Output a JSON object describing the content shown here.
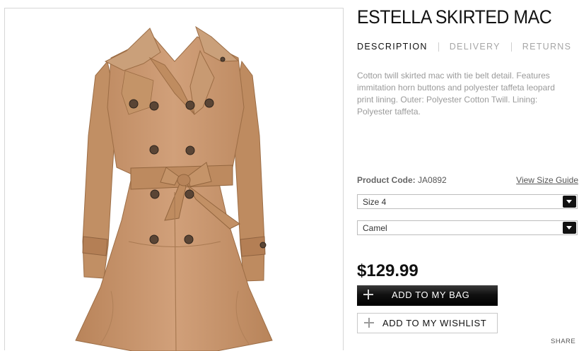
{
  "product": {
    "title": "ESTELLA SKIRTED MAC",
    "tabs": [
      "DESCRIPTION",
      "DELIVERY",
      "RETURNS"
    ],
    "active_tab": "DESCRIPTION",
    "description": "Cotton twill skirted mac with tie belt detail. Features immitation horn buttons and polyester taffeta leopard print lining. Outer: Polyester Cotton Twill. Lining: Polyester taffeta.",
    "code_label": "Product Code:",
    "code_value": "JA0892",
    "size_guide_link": "View Size Guide",
    "size_select": "Size 4",
    "color_select": "Camel",
    "price": "$129.99",
    "add_to_bag": "ADD TO MY BAG",
    "add_to_wishlist": "ADD TO MY WISHLIST",
    "share": "SHARE",
    "image_alt_color": "#c9976b"
  },
  "icons": {
    "plus": "plus-icon",
    "dropdown": "chevron-down-icon"
  }
}
